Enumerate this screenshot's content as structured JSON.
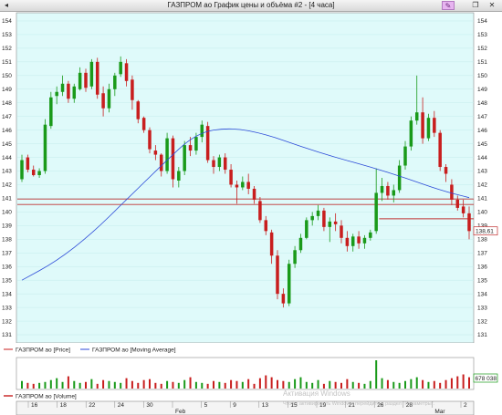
{
  "window": {
    "title": "ГАЗПРОМ ао График цены и объёма #2 - [4 часа]",
    "left_button": "◂",
    "pen_button": "✎",
    "restore_button": "❐",
    "close_button": "✕"
  },
  "colors": {
    "up": "#1a9a1a",
    "down": "#c81e1e",
    "ma": "#2c4ad8",
    "background": "#dffafa",
    "level": "#c03030",
    "volume_background": "#ffffff"
  },
  "legend": {
    "price_label": "ГАЗПРОМ ао [Price]",
    "ma_label": "ГАЗПРОМ ао [Moving Average]",
    "volume_label": "ГАЗПРОМ ао [Volume]"
  },
  "watermark": {
    "line1": "Активация Windows",
    "line2": "Чтобы активировать Windows, перейдите в раздел \"Параметры\"."
  },
  "chart_data": {
    "type": "candlestick",
    "y_axis": {
      "min": 130.4,
      "max": 154.6,
      "ticks": [
        131,
        132,
        133,
        134,
        135,
        136,
        137,
        138,
        139,
        140,
        141,
        142,
        143,
        144,
        145,
        146,
        147,
        148,
        149,
        150,
        151,
        152,
        153,
        154
      ],
      "labels": [
        "131",
        "132",
        "133",
        "134",
        "135",
        "136",
        "137",
        "138",
        "139",
        "140",
        "141",
        "142",
        "143",
        "144",
        "145",
        "146",
        "147",
        "148",
        "149",
        "150",
        "151",
        "152",
        "153",
        "154"
      ]
    },
    "x_axis": {
      "labels": [
        "16",
        "18",
        "22",
        "24",
        "30",
        "Feb",
        "5",
        "9",
        "13",
        "15",
        "19",
        "21",
        "26",
        "28",
        "Mar",
        "2"
      ]
    },
    "candles": [
      {
        "o": 142.4,
        "h": 144.2,
        "l": 142.2,
        "c": 143.8
      },
      {
        "o": 144.0,
        "h": 144.2,
        "l": 142.9,
        "c": 143.1
      },
      {
        "o": 143.1,
        "h": 143.4,
        "l": 142.6,
        "c": 142.7
      },
      {
        "o": 142.7,
        "h": 143.2,
        "l": 142.5,
        "c": 143.0
      },
      {
        "o": 143.0,
        "h": 146.8,
        "l": 142.8,
        "c": 146.4
      },
      {
        "o": 146.3,
        "h": 148.8,
        "l": 146.1,
        "c": 148.4
      },
      {
        "o": 148.5,
        "h": 149.2,
        "l": 147.9,
        "c": 148.8
      },
      {
        "o": 148.8,
        "h": 150.0,
        "l": 148.5,
        "c": 149.4
      },
      {
        "o": 149.4,
        "h": 149.6,
        "l": 148.0,
        "c": 148.3
      },
      {
        "o": 148.3,
        "h": 149.4,
        "l": 148.0,
        "c": 149.2
      },
      {
        "o": 149.0,
        "h": 150.6,
        "l": 148.9,
        "c": 150.2
      },
      {
        "o": 150.2,
        "h": 150.5,
        "l": 148.8,
        "c": 149.1
      },
      {
        "o": 149.2,
        "h": 151.2,
        "l": 149.0,
        "c": 151.0
      },
      {
        "o": 151.0,
        "h": 151.3,
        "l": 148.3,
        "c": 148.6
      },
      {
        "o": 148.7,
        "h": 149.2,
        "l": 147.0,
        "c": 147.6
      },
      {
        "o": 147.6,
        "h": 149.4,
        "l": 147.3,
        "c": 149.0
      },
      {
        "o": 149.0,
        "h": 150.2,
        "l": 148.5,
        "c": 150.0
      },
      {
        "o": 150.1,
        "h": 151.4,
        "l": 149.9,
        "c": 151.0
      },
      {
        "o": 150.9,
        "h": 151.2,
        "l": 149.2,
        "c": 149.6
      },
      {
        "o": 149.7,
        "h": 150.0,
        "l": 147.5,
        "c": 148.2
      },
      {
        "o": 148.1,
        "h": 148.2,
        "l": 146.5,
        "c": 146.8
      },
      {
        "o": 146.9,
        "h": 147.0,
        "l": 145.8,
        "c": 146.0
      },
      {
        "o": 146.0,
        "h": 146.2,
        "l": 144.3,
        "c": 144.6
      },
      {
        "o": 144.5,
        "h": 144.9,
        "l": 143.8,
        "c": 144.2
      },
      {
        "o": 144.2,
        "h": 144.3,
        "l": 142.6,
        "c": 143.0
      },
      {
        "o": 143.0,
        "h": 145.8,
        "l": 142.8,
        "c": 145.4
      },
      {
        "o": 145.4,
        "h": 145.6,
        "l": 141.8,
        "c": 142.4
      },
      {
        "o": 142.3,
        "h": 143.3,
        "l": 141.8,
        "c": 143.0
      },
      {
        "o": 143.0,
        "h": 145.2,
        "l": 142.7,
        "c": 144.9
      },
      {
        "o": 144.9,
        "h": 145.5,
        "l": 144.1,
        "c": 144.5
      },
      {
        "o": 144.5,
        "h": 145.8,
        "l": 144.2,
        "c": 145.5
      },
      {
        "o": 145.5,
        "h": 146.7,
        "l": 145.1,
        "c": 146.4
      },
      {
        "o": 146.3,
        "h": 146.6,
        "l": 143.6,
        "c": 143.8
      },
      {
        "o": 143.8,
        "h": 144.1,
        "l": 142.8,
        "c": 143.3
      },
      {
        "o": 143.3,
        "h": 144.2,
        "l": 143.0,
        "c": 144.0
      },
      {
        "o": 144.0,
        "h": 144.3,
        "l": 142.8,
        "c": 143.1
      },
      {
        "o": 143.1,
        "h": 143.5,
        "l": 141.8,
        "c": 142.0
      },
      {
        "o": 142.0,
        "h": 142.3,
        "l": 140.6,
        "c": 141.8
      },
      {
        "o": 141.8,
        "h": 142.6,
        "l": 141.6,
        "c": 142.2
      },
      {
        "o": 142.2,
        "h": 142.8,
        "l": 141.3,
        "c": 141.7
      },
      {
        "o": 141.7,
        "h": 141.9,
        "l": 140.6,
        "c": 140.9
      },
      {
        "o": 140.8,
        "h": 141.1,
        "l": 139.2,
        "c": 139.4
      },
      {
        "o": 139.4,
        "h": 139.7,
        "l": 138.3,
        "c": 138.6
      },
      {
        "o": 138.5,
        "h": 138.7,
        "l": 136.2,
        "c": 136.8
      },
      {
        "o": 136.8,
        "h": 137.2,
        "l": 133.6,
        "c": 134.0
      },
      {
        "o": 134.0,
        "h": 134.4,
        "l": 133.0,
        "c": 133.3
      },
      {
        "o": 133.3,
        "h": 136.5,
        "l": 133.1,
        "c": 136.2
      },
      {
        "o": 136.2,
        "h": 137.5,
        "l": 135.9,
        "c": 137.2
      },
      {
        "o": 137.2,
        "h": 138.4,
        "l": 137.0,
        "c": 138.1
      },
      {
        "o": 138.1,
        "h": 139.6,
        "l": 138.0,
        "c": 139.4
      },
      {
        "o": 139.4,
        "h": 140.0,
        "l": 139.0,
        "c": 139.7
      },
      {
        "o": 139.7,
        "h": 140.5,
        "l": 139.4,
        "c": 140.1
      },
      {
        "o": 140.1,
        "h": 140.3,
        "l": 138.6,
        "c": 138.9
      },
      {
        "o": 138.9,
        "h": 139.6,
        "l": 137.8,
        "c": 139.3
      },
      {
        "o": 139.3,
        "h": 139.9,
        "l": 138.6,
        "c": 139.1
      },
      {
        "o": 139.0,
        "h": 139.4,
        "l": 137.7,
        "c": 138.1
      },
      {
        "o": 138.1,
        "h": 138.6,
        "l": 137.1,
        "c": 137.5
      },
      {
        "o": 137.5,
        "h": 138.4,
        "l": 137.1,
        "c": 138.2
      },
      {
        "o": 138.2,
        "h": 138.6,
        "l": 137.3,
        "c": 137.7
      },
      {
        "o": 137.7,
        "h": 138.3,
        "l": 137.3,
        "c": 138.1
      },
      {
        "o": 138.1,
        "h": 138.7,
        "l": 137.9,
        "c": 138.5
      },
      {
        "o": 138.6,
        "h": 143.2,
        "l": 138.4,
        "c": 141.4
      },
      {
        "o": 141.4,
        "h": 142.5,
        "l": 140.8,
        "c": 141.9
      },
      {
        "o": 141.9,
        "h": 142.2,
        "l": 140.9,
        "c": 141.2
      },
      {
        "o": 141.2,
        "h": 142.0,
        "l": 140.7,
        "c": 141.6
      },
      {
        "o": 141.6,
        "h": 143.8,
        "l": 141.4,
        "c": 143.4
      },
      {
        "o": 143.4,
        "h": 145.2,
        "l": 143.1,
        "c": 144.8
      },
      {
        "o": 144.8,
        "h": 147.0,
        "l": 144.5,
        "c": 146.7
      },
      {
        "o": 146.7,
        "h": 150.0,
        "l": 146.4,
        "c": 147.3
      },
      {
        "o": 147.3,
        "h": 148.4,
        "l": 145.0,
        "c": 145.4
      },
      {
        "o": 145.4,
        "h": 147.2,
        "l": 145.2,
        "c": 146.9
      },
      {
        "o": 146.9,
        "h": 147.4,
        "l": 145.5,
        "c": 145.8
      },
      {
        "o": 145.8,
        "h": 146.0,
        "l": 143.0,
        "c": 143.3
      },
      {
        "o": 143.3,
        "h": 143.5,
        "l": 142.2,
        "c": 142.8
      },
      {
        "o": 142.0,
        "h": 142.4,
        "l": 140.5,
        "c": 140.9
      },
      {
        "o": 140.9,
        "h": 141.2,
        "l": 140.1,
        "c": 140.3
      },
      {
        "o": 140.4,
        "h": 140.9,
        "l": 139.6,
        "c": 139.9
      },
      {
        "o": 139.9,
        "h": 140.4,
        "l": 138.0,
        "c": 138.6
      }
    ],
    "moving_average": [
      [
        0,
        135.0
      ],
      [
        6,
        136.4
      ],
      [
        12,
        138.4
      ],
      [
        18,
        140.9
      ],
      [
        24,
        143.4
      ],
      [
        30,
        145.8
      ],
      [
        36,
        146.2
      ],
      [
        42,
        145.7
      ],
      [
        48,
        144.8
      ],
      [
        54,
        144.0
      ],
      [
        60,
        143.3
      ],
      [
        66,
        142.5
      ],
      [
        72,
        141.6
      ],
      [
        77,
        141.05
      ]
    ],
    "levels": [
      {
        "price": 140.95,
        "from": 0,
        "to": 77
      },
      {
        "price": 140.55,
        "from": 0,
        "to": 77
      },
      {
        "price": 139.5,
        "from": 62,
        "to": 77
      }
    ],
    "last_price": "138,61",
    "volume": {
      "values": [
        8,
        6,
        5,
        6,
        7,
        9,
        11,
        7,
        13,
        8,
        6,
        7,
        10,
        5,
        9,
        8,
        7,
        6,
        11,
        8,
        6,
        9,
        10,
        6,
        5,
        8,
        7,
        6,
        9,
        12,
        7,
        6,
        5,
        8,
        7,
        6,
        9,
        8,
        7,
        10,
        5,
        11,
        14,
        12,
        9,
        8,
        7,
        10,
        12,
        7,
        6,
        9,
        5,
        8,
        7,
        6,
        10,
        7,
        6,
        5,
        8,
        30,
        11,
        9,
        7,
        6,
        8,
        10,
        12,
        9,
        7,
        8,
        6,
        9,
        11,
        13,
        15,
        12
      ],
      "max": 30,
      "last_label": "678 038"
    }
  }
}
